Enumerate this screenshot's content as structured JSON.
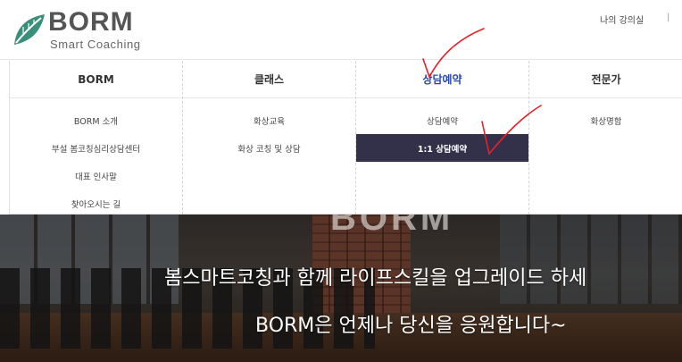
{
  "header": {
    "logo_text": "BORM",
    "logo_subtitle": "Smart Coaching",
    "top_link": "나의 강의실",
    "top_sep": "|"
  },
  "menu": {
    "columns": [
      {
        "title": "BORM",
        "active": false,
        "items": [
          "BORM 소개",
          "부설 봄코칭심리상담센터",
          "대표 인사말",
          "찾아오시는 길"
        ]
      },
      {
        "title": "클래스",
        "active": false,
        "items": [
          "화상교육",
          "화상 코칭 및 상담"
        ]
      },
      {
        "title": "상담예약",
        "active": true,
        "items": [
          "상담예약",
          "1:1 상담예약"
        ]
      },
      {
        "title": "전문가",
        "active": false,
        "items": [
          "화상명함"
        ]
      }
    ],
    "selected_item": "1:1 상담예약"
  },
  "hero": {
    "ghost_text": "BORM",
    "line1": "봄스마트코칭과 함께 라이프스킬을 업그레이드 하세",
    "line2": "BORM은 언제나 당신을 응원합니다~"
  },
  "colors": {
    "accent": "#2b4aa8",
    "selected_bg": "#33304a",
    "annotation": "#e8202a",
    "logo_leaf": "#3a8f7a"
  }
}
